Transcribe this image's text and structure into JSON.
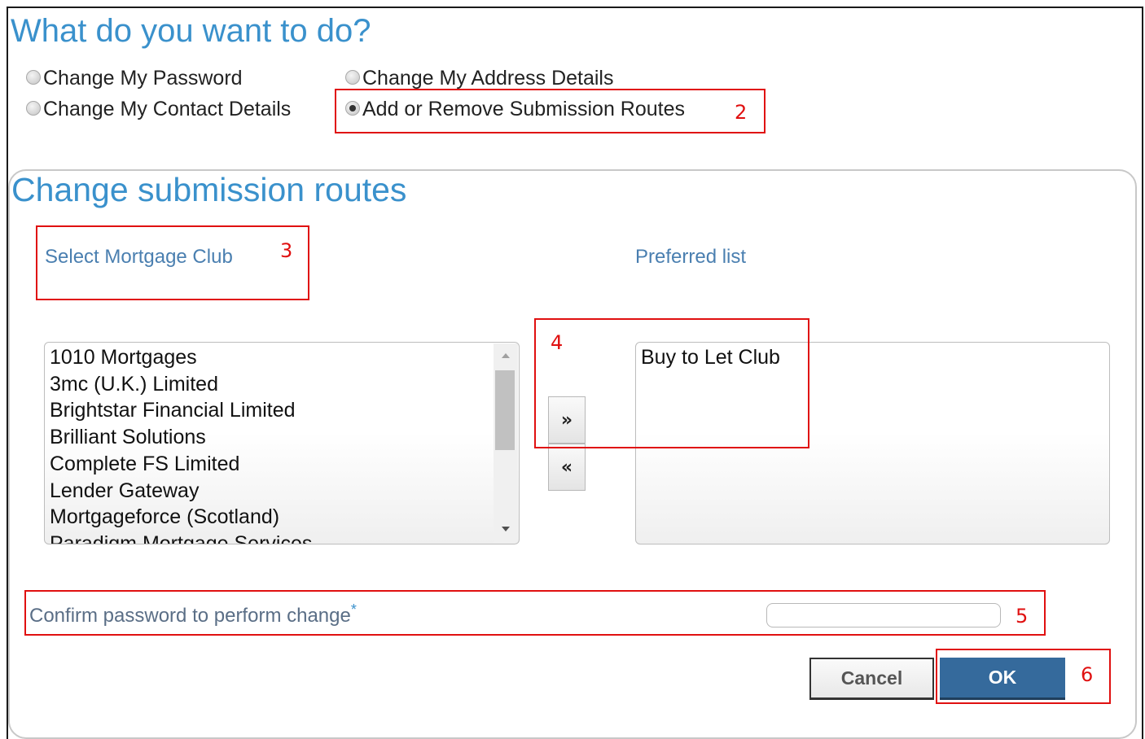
{
  "header": {
    "title": "What do you want to do?"
  },
  "options": [
    {
      "label": "Change My Password",
      "checked": false
    },
    {
      "label": "Change My Address Details",
      "checked": false
    },
    {
      "label": "Change My Contact Details",
      "checked": false
    },
    {
      "label": "Add or Remove Submission Routes",
      "checked": true
    }
  ],
  "section": {
    "title": "Change submission routes",
    "select_label": "Select Mortgage Club",
    "preferred_label": "Preferred list",
    "available": [
      "1010 Mortgages",
      "3mc (U.K.) Limited",
      "Brightstar Financial Limited",
      "Brilliant Solutions",
      "Complete FS Limited",
      "Lender Gateway",
      "Mortgageforce (Scotland)",
      "Paradigm Mortgage Services"
    ],
    "preferred": [
      "Buy to Let Club"
    ],
    "add_label": "»",
    "remove_label": "«",
    "confirm_label": "Confirm password to perform change",
    "required_mark": "*",
    "password_value": "",
    "cancel_label": "Cancel",
    "ok_label": "OK"
  },
  "annotations": {
    "radio_box": "2",
    "select_label_box": "3",
    "move_box": "4",
    "password_box": "5",
    "ok_box": "6"
  },
  "colors": {
    "heading": "#3a91cc",
    "label": "#4a7fb0",
    "annotation": "#e01010",
    "ok_button": "#356a9c"
  }
}
